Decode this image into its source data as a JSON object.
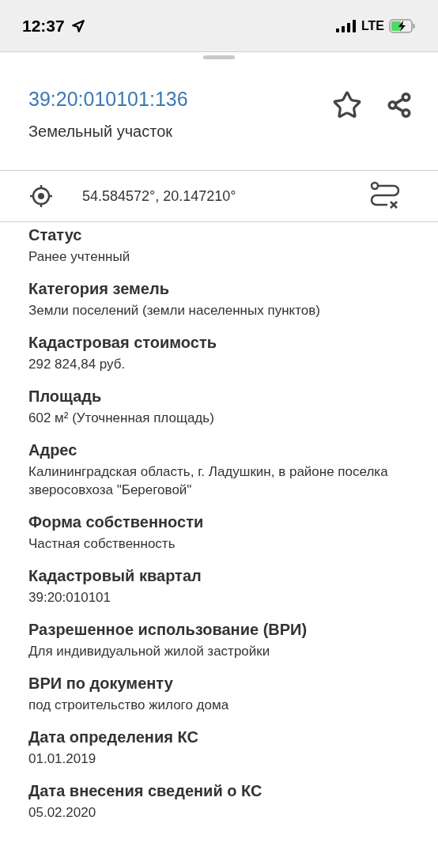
{
  "status_bar": {
    "time": "12:37",
    "network": "LTE"
  },
  "header": {
    "title": "39:20:010101:136",
    "subtitle": "Земельный участок",
    "favorite": false
  },
  "coordinates": "54.584572°, 20.147210°",
  "fields": [
    {
      "label": "Статус",
      "value": "Ранее учтенный"
    },
    {
      "label": "Категория земель",
      "value": "Земли поселений (земли населенных пунктов)"
    },
    {
      "label": "Кадастровая стоимость",
      "value": "292 824,84 руб."
    },
    {
      "label": "Площадь",
      "value": "602 м² (Уточненная площадь)"
    },
    {
      "label": "Адрес",
      "value": "Калининградская область, г. Ладушкин, в районе поселка зверосовхоза \"Береговой\""
    },
    {
      "label": "Форма собственности",
      "value": "Частная собственность"
    },
    {
      "label": "Кадастровый квартал",
      "value": "39:20:010101"
    },
    {
      "label": "Разрешенное использование (ВРИ)",
      "value": "Для индивидуальной жилой застройки"
    },
    {
      "label": "ВРИ по документу",
      "value": "под строительство жилого дома"
    },
    {
      "label": "Дата определения КС",
      "value": "01.01.2019"
    },
    {
      "label": "Дата внесения сведений о КС",
      "value": "05.02.2020"
    }
  ]
}
